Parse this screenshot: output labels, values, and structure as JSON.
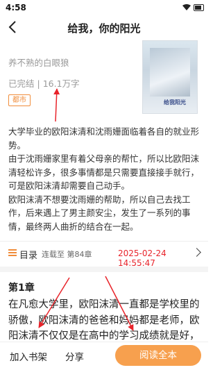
{
  "status_bar": {
    "time": "4:58",
    "wifi_icon": "wifi-icon",
    "battery_icon": "battery-icon"
  },
  "header": {
    "title": "给我，你的阳光",
    "back_icon": "back-arrow-icon"
  },
  "book": {
    "author": "养不熟的白眼狼",
    "status": "已完结",
    "word_count": "16.1万字",
    "separator": "|",
    "tag": "都市",
    "cover_title": "给我阳光"
  },
  "description": [
    "大学毕业的欧阳沫清和沈雨姗面临着各自的就业形势。",
    "由于沈雨姗家里有着父母亲的帮忙，所以比欧阳沫清轻松许多，很多事情都是只需要直接接手就行，可是欧阳沫清却需要自己动手。",
    "欧阳沫清不想要沈雨姗的帮助，所以自己去找工作，后来遇上了男主颜安尘，发生了一系列的事情，最终两人曲折的结合在一起。"
  ],
  "toc": {
    "label": "目录",
    "status": "连载至 第84章",
    "timestamp": "2025-02-24 14:55:47",
    "list_icon": "list-icon",
    "chevron_icon": "chevron-right-icon"
  },
  "chapter": {
    "title": "第1章",
    "text": "在凡愈大学里，欧阳沫清一直都是学校里的骄傲，欧阳沫清的爸爸和妈妈都是老师，欧阳沫清不仅仅是在高中的学习成绩就是好，"
  },
  "bottom_bar": {
    "add_shelf": "加入书架",
    "share": "分享",
    "read_all": "阅读全本"
  },
  "colors": {
    "accent": "#f7a04e",
    "tag": "#f08c3a",
    "annotation": "#e8232a"
  }
}
